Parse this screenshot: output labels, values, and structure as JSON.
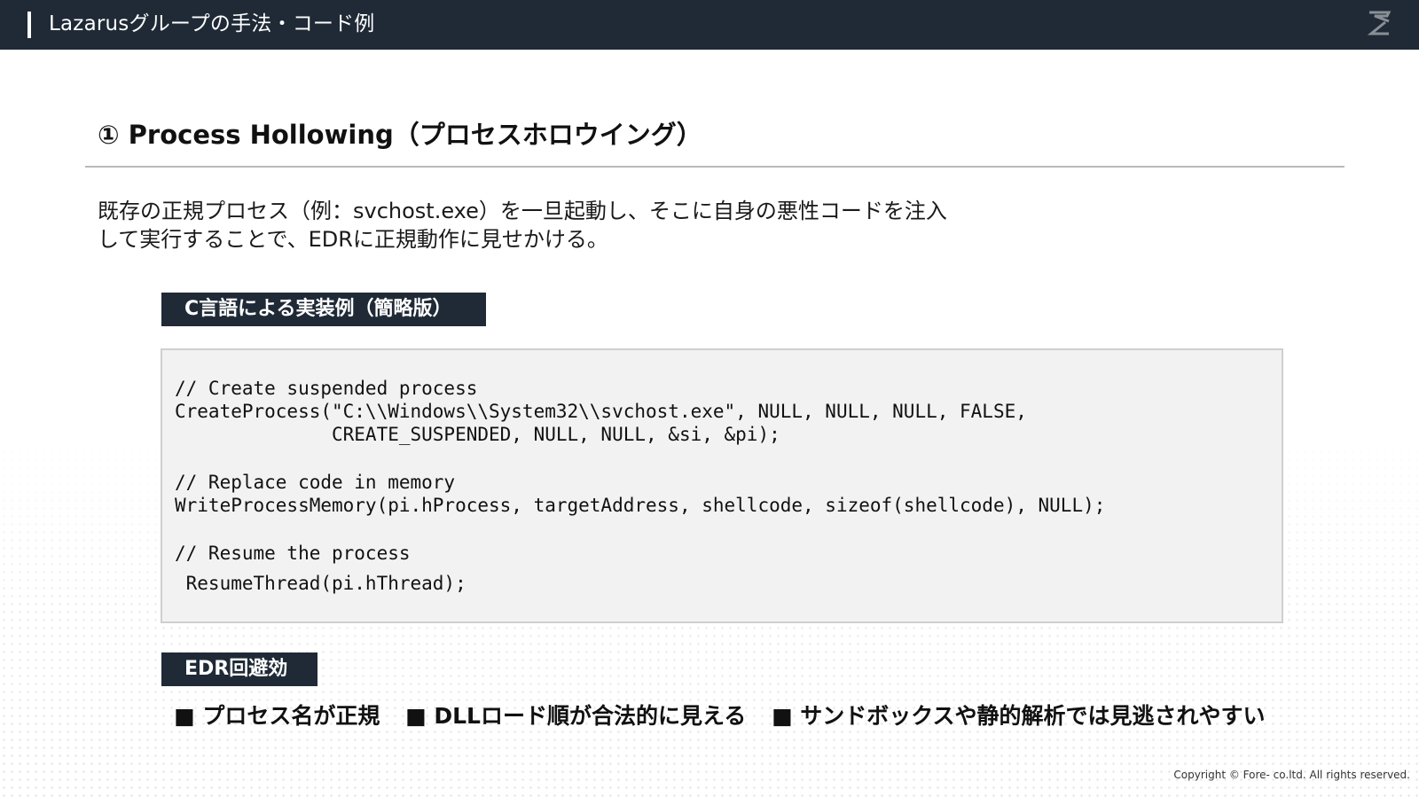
{
  "header": {
    "title": "Lazarusグループの手法・コード例",
    "logo_icon": "z-logo-icon"
  },
  "section": {
    "title": "① Process Hollowing（プロセスホロウイング）"
  },
  "description": {
    "line1": "既存の正規プロセス（例：svchost.exe）を一旦起動し、そこに自身の悪性コードを注入",
    "line2": "して実行することで、EDRに正規動作に見せかける。"
  },
  "code_label": "C言語による実装例（簡略版）",
  "code": {
    "lines": [
      "// Create suspended process",
      "CreateProcess(\"C:\\\\Windows\\\\System32\\\\svchost.exe\", NULL, NULL, NULL, FALSE,",
      "              CREATE_SUSPENDED, NULL, NULL, &si, &pi);",
      "// Replace code in memory",
      "WriteProcessMemory(pi.hProcess, targetAddress, shellcode, sizeof(shellcode), NULL);",
      "// Resume the process",
      " ResumeThread(pi.hThread);"
    ]
  },
  "edr_label": "EDR回避効",
  "edr_points": [
    "■ プロセス名が正規",
    "■ DLLロード順が合法的に見える",
    "■ サンドボックスや静的解析では見逃されやすい"
  ],
  "footer": {
    "copyright": "Copyright © Fore- co.ltd. All rights reserved."
  },
  "colors": {
    "header_bg": "#1f2a36",
    "code_bg": "#f2f2f2",
    "tag_bg": "#1f2a36"
  }
}
